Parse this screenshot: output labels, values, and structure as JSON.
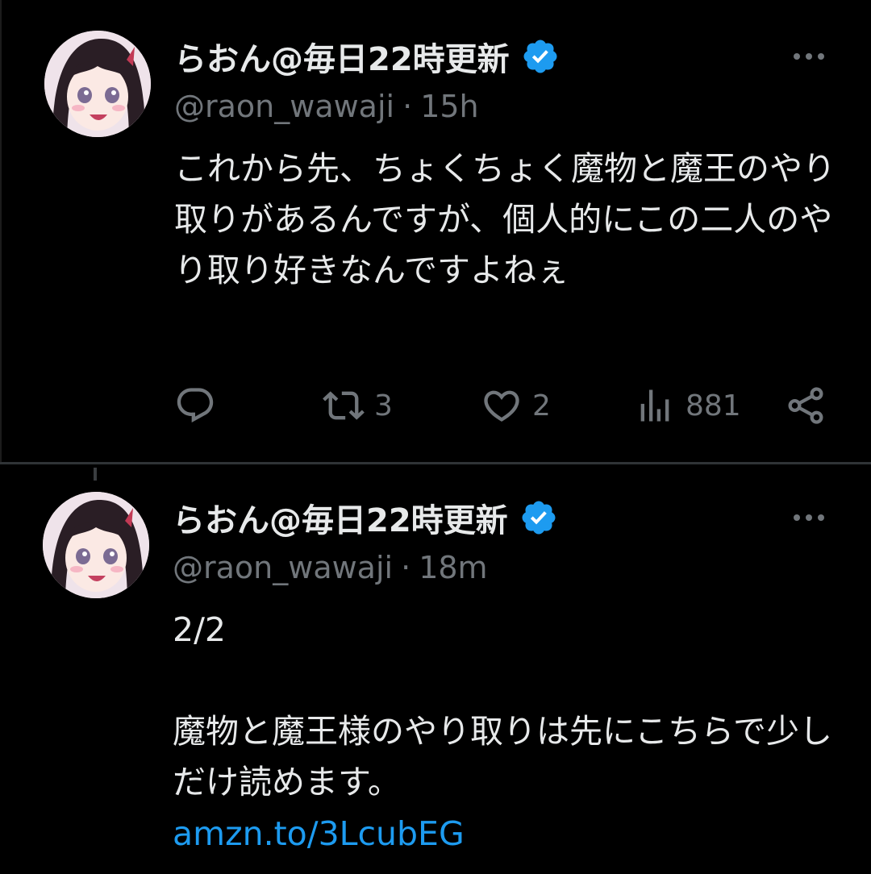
{
  "tweets": [
    {
      "display_name": "らおん@毎日22時更新",
      "handle": "@raon_wawaji",
      "separator": "·",
      "time": "15h",
      "text": "これから先、ちょくちょく魔物と魔王のやり取りがあるんですが、個人的にこの二人のやり取り好きなんですよねぇ",
      "actions": {
        "reply_count": "",
        "retweet_count": "3",
        "like_count": "2",
        "views_count": "881"
      }
    },
    {
      "display_name": "らおん@毎日22時更新",
      "handle": "@raon_wawaji",
      "separator": "·",
      "time": "18m",
      "text": "2/2\n\n魔物と魔王様のやり取りは先にこちらで少しだけ読めます。",
      "link": "amzn.to/3LcubEG"
    }
  ],
  "colors": {
    "background": "#000000",
    "text": "#e7e9ea",
    "muted": "#71767b",
    "link": "#1d9bf0",
    "verified": "#1d9bf0"
  },
  "icons": [
    "reply-icon",
    "retweet-icon",
    "like-icon",
    "views-icon",
    "share-icon",
    "verified-badge-icon",
    "more-icon"
  ]
}
